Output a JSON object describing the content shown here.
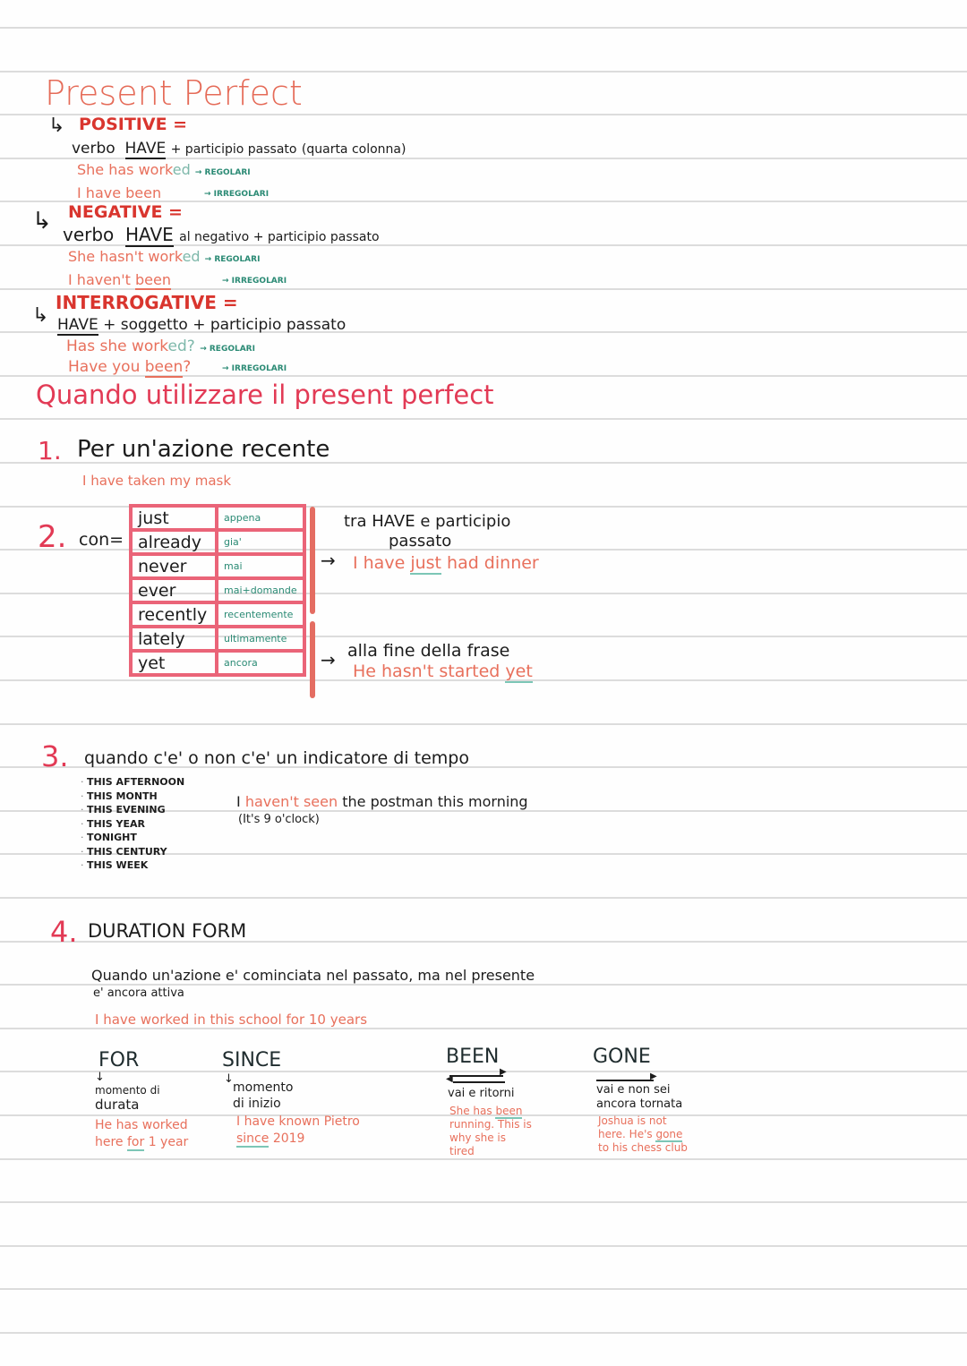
{
  "page": {
    "title": "Present Perfect",
    "positive": {
      "heading": "POSITIVE =",
      "rule_prefix": "verbo",
      "rule_have": "HAVE",
      "rule_suffix": "+ participio passato",
      "rule_note": "(quarta colonna)",
      "examples": [
        {
          "text_main": "She has work",
          "text_ending": "ed",
          "tag": "→ REGOLARI"
        },
        {
          "text_main": "I have been",
          "text_ending": "",
          "tag": "→ IRREGOLARI"
        }
      ]
    },
    "negative": {
      "heading": "NEGATIVE =",
      "rule_prefix": "verbo",
      "rule_have": "HAVE",
      "rule_suffix": "al negativo + participio passato",
      "examples": [
        {
          "text_main": "She hasn't work",
          "text_ending": "ed",
          "tag": "→ REGOLARI"
        },
        {
          "text_main": "I haven't ",
          "text_underlined": "been",
          "tag": "→ IRREGOLARI"
        }
      ]
    },
    "interrogative": {
      "heading": "INTERROGATIVE =",
      "rule_have": "HAVE",
      "rule_suffix": "+ soggetto + participio passato",
      "examples": [
        {
          "text_main": "Has she work",
          "text_ending": "ed?",
          "tag": "→ REGOLARI"
        },
        {
          "text_main": "Have you ",
          "text_underlined": "been",
          "text_end": "?",
          "tag": "→ IRREGOLARI"
        }
      ]
    },
    "usage_heading": "Quando utilizzare il present perfect",
    "usage": [
      {
        "number": "1.",
        "title": "Per un'azione recente",
        "example": "I have taken my mask"
      },
      {
        "number": "2.",
        "label": "con=",
        "adverbs": [
          {
            "en": "just",
            "it": "appena"
          },
          {
            "en": "already",
            "it": "gia'"
          },
          {
            "en": "never",
            "it": "mai"
          },
          {
            "en": "ever",
            "it": "mai+domande"
          },
          {
            "en": "recently",
            "it": "recentemente"
          },
          {
            "en": "lately",
            "it": "ultimamente"
          },
          {
            "en": "yet",
            "it": "ancora"
          }
        ],
        "group1": {
          "note_line1": "tra HAVE e participio",
          "note_line2": "passato",
          "arrow": "→",
          "example_pre": "I have ",
          "example_key": "just",
          "example_post": " had dinner"
        },
        "group2": {
          "arrow": "→",
          "note": "alla fine della frase",
          "example_pre": "He hasn't started ",
          "example_key": "yet"
        }
      },
      {
        "number": "3.",
        "title": "quando c'e' o non c'e' un indicatore di tempo",
        "time_expressions": [
          "THIS AFTERNOON",
          "THIS MONTH",
          "THIS EVENING",
          "THIS YEAR",
          "TONIGHT",
          "THIS CENTURY",
          "THIS WEEK"
        ],
        "example_pre": "I ",
        "example_key": "haven't seen",
        "example_post": " the postman this morning",
        "example_note": "(It's 9 o'clock)"
      },
      {
        "number": "4.",
        "title": "DURATION FORM",
        "desc_line1": "Quando un'azione e' cominciata nel passato, ma nel presente",
        "desc_line2": "e' ancora attiva",
        "example": "I have worked in this school for 10 years",
        "columns": [
          {
            "heading": "FOR",
            "arrow": "↓",
            "note_lines": [
              "momento di",
              "durata"
            ],
            "example_lines": [
              "He has worked",
              "here "
            ],
            "example_key": "for",
            "example_tail": " 1 year"
          },
          {
            "heading": "SINCE",
            "arrow": "↓",
            "note_lines": [
              "momento",
              "di inizio"
            ],
            "example_lines": [
              "I have known Pietro"
            ],
            "example_key": "since",
            "example_tail": " 2019"
          },
          {
            "heading": "BEEN",
            "arrow": "⇄",
            "note_lines": [
              "vai e ritorni"
            ],
            "example_lines": [
              "She has ",
              "running. This is",
              "why she is",
              "tired"
            ],
            "example_key": "been"
          },
          {
            "heading": "GONE",
            "arrow": "→",
            "note_lines": [
              "vai e non sei",
              "ancora tornata"
            ],
            "example_lines": [
              "Joshua is not",
              "here. He's ",
              "to his chess club"
            ],
            "example_key": "gone"
          }
        ]
      }
    ]
  }
}
